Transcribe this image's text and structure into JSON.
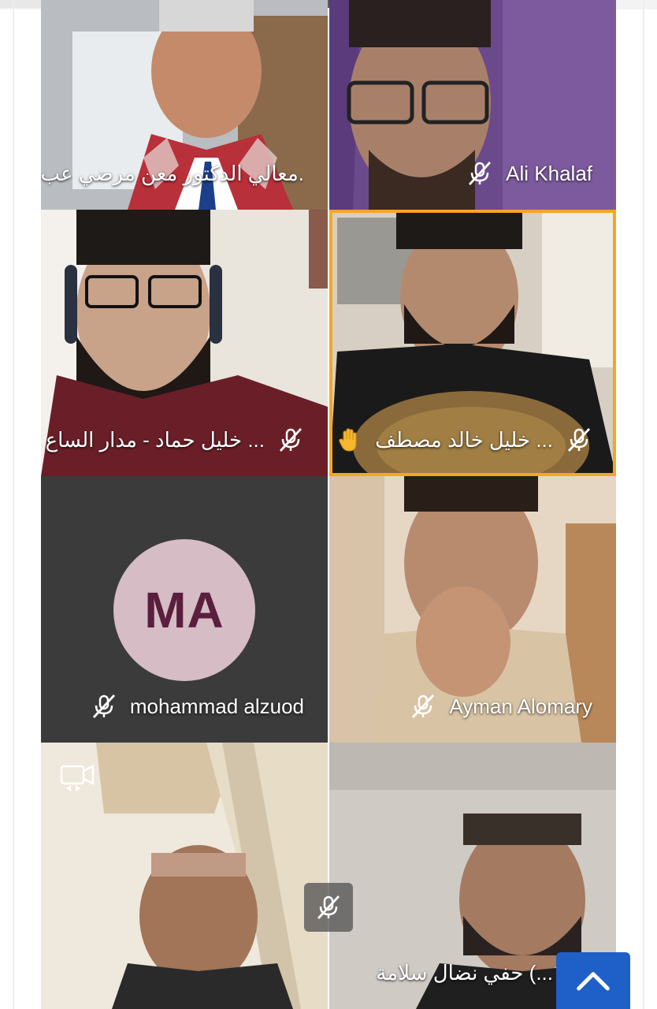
{
  "participants": [
    {
      "name": "معالي الدكتور معن مرضي عب.",
      "muted": false,
      "hand_raised": false,
      "video": true
    },
    {
      "name": "Ali Khalaf",
      "muted": true,
      "hand_raised": false,
      "video": true
    },
    {
      "name": "خليل حماد - مدار الساع ...",
      "muted": true,
      "hand_raised": false,
      "video": true
    },
    {
      "name": "خليل خالد مصطف ...",
      "muted": true,
      "hand_raised": true,
      "video": true,
      "active": true
    },
    {
      "name": "mohammad alzuod",
      "muted": true,
      "hand_raised": false,
      "video": false,
      "initials": "MA"
    },
    {
      "name": "Ayman Alomary",
      "muted": true,
      "hand_raised": false,
      "video": true
    },
    {
      "name": "",
      "muted": true,
      "hand_raised": false,
      "video": true
    },
    {
      "name": "حفي نضال سلامة (...",
      "muted": true,
      "hand_raised": false,
      "video": true
    }
  ],
  "colors": {
    "active_speaker_border": "#f5a623",
    "avatar_bg": "#d6bcc4",
    "avatar_text": "#5a1e3e",
    "scroll_button": "#1f5fc8"
  },
  "icons": {
    "mute": "mic-off-icon",
    "hand": "raised-hand-icon",
    "camera_switch": "camera-switch-icon",
    "scroll": "chevron-up-icon"
  }
}
